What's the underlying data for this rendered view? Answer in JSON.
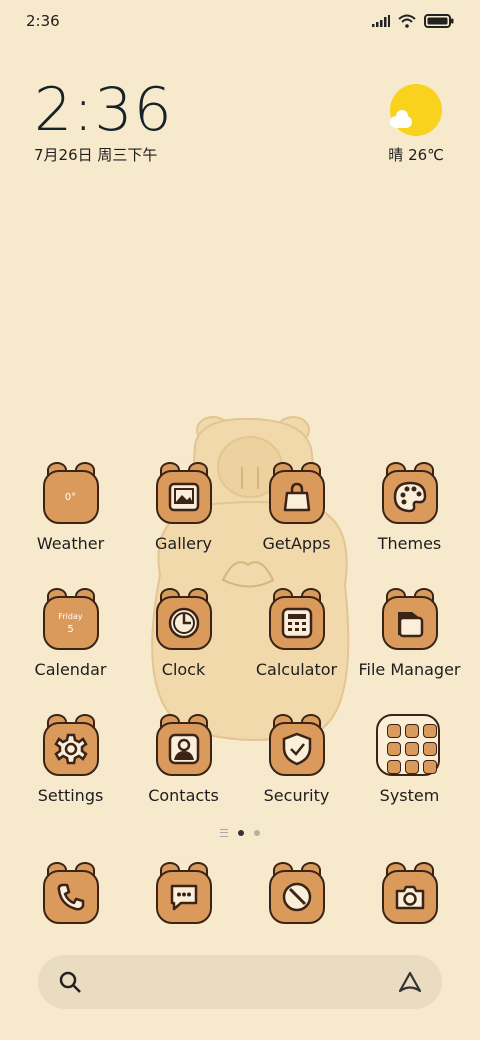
{
  "status_bar": {
    "time": "2:36"
  },
  "clock_widget": {
    "time": "2:36",
    "date": "7月26日 周三下午"
  },
  "weather_widget": {
    "text": "晴 26℃"
  },
  "apps": [
    {
      "label": "Weather",
      "icon": "weather-icon",
      "tile_text": "0°"
    },
    {
      "label": "Gallery",
      "icon": "gallery-icon"
    },
    {
      "label": "GetApps",
      "icon": "bag-icon"
    },
    {
      "label": "Themes",
      "icon": "palette-icon"
    },
    {
      "label": "Calendar",
      "icon": "calendar-icon",
      "tile_text": "Friday",
      "tile_sub": "5"
    },
    {
      "label": "Clock",
      "icon": "clock-icon"
    },
    {
      "label": "Calculator",
      "icon": "calculator-icon"
    },
    {
      "label": "File Manager",
      "icon": "folder-icon"
    },
    {
      "label": "Settings",
      "icon": "gear-icon"
    },
    {
      "label": "Contacts",
      "icon": "contact-icon"
    },
    {
      "label": "Security",
      "icon": "shield-icon"
    },
    {
      "label": "System",
      "icon": "system-folder-icon"
    }
  ],
  "dock": [
    {
      "name": "phone",
      "icon": "phone-icon"
    },
    {
      "name": "messages",
      "icon": "message-icon"
    },
    {
      "name": "browser",
      "icon": "compass-icon"
    },
    {
      "name": "camera",
      "icon": "camera-icon"
    }
  ],
  "page_indicator": {
    "pages": 2,
    "current": 1
  },
  "colors": {
    "background": "#f7e9cc",
    "tile": "#d99a5b",
    "outline": "#3b2417",
    "sun": "#f8d21c"
  }
}
